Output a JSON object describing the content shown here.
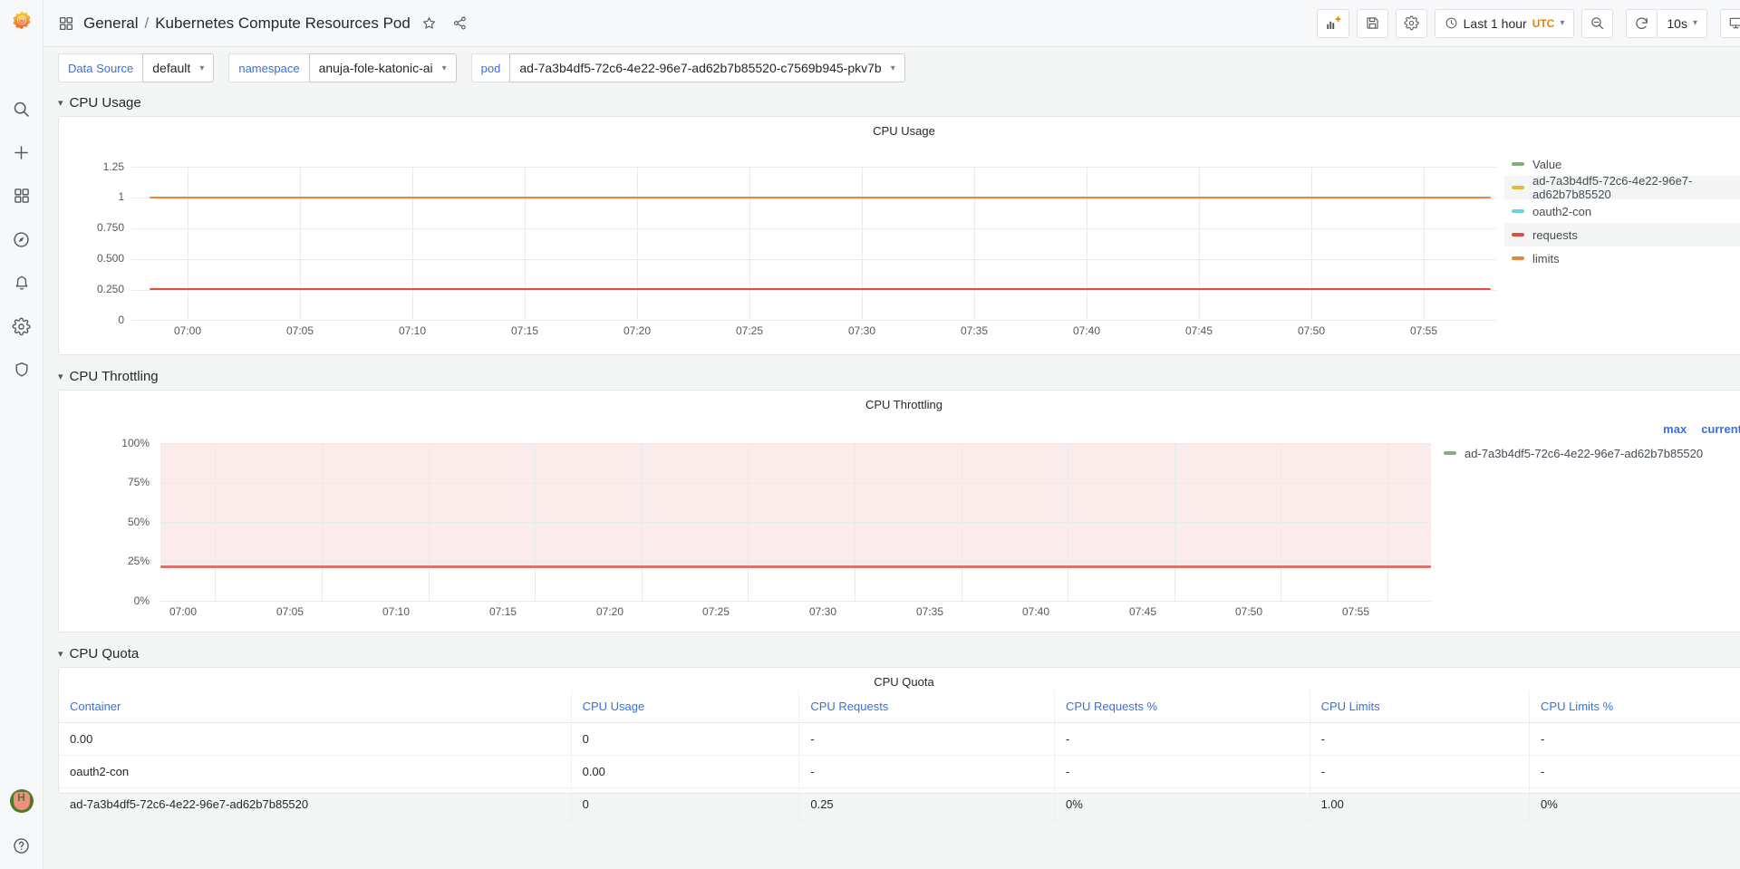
{
  "sidebar": {
    "logo": "grafana-logo",
    "items": [
      {
        "name": "search-icon",
        "label": "Search"
      },
      {
        "name": "plus-icon",
        "label": "Create"
      },
      {
        "name": "dashboards-icon",
        "label": "Dashboards"
      },
      {
        "name": "explore-compass-icon",
        "label": "Explore"
      },
      {
        "name": "alerting-bell-icon",
        "label": "Alerting"
      },
      {
        "name": "configuration-gear-icon",
        "label": "Configuration"
      },
      {
        "name": "shield-icon",
        "label": "Server Admin"
      }
    ],
    "bottom": [
      {
        "name": "avatar",
        "label": "H"
      },
      {
        "name": "help-icon",
        "label": "?"
      }
    ]
  },
  "topnav": {
    "folder": "General",
    "separator": "/",
    "dashboard_title": "Kubernetes Compute Resources Pod",
    "star_icon": "star-icon",
    "share_icon": "share-icon",
    "buttons": [
      {
        "name": "add-panel-button",
        "icon": "add-panel-icon"
      },
      {
        "name": "save-dashboard-button",
        "icon": "save-icon"
      },
      {
        "name": "dashboard-settings-button",
        "icon": "gear-icon"
      }
    ],
    "time_range": {
      "label": "Last 1 hour",
      "timezone": "UTC",
      "icon": "clock-icon"
    },
    "zoom_out": {
      "name": "zoom-out-button",
      "icon": "zoom-out-icon"
    },
    "refresh": {
      "name": "refresh-button",
      "icon": "refresh-icon"
    },
    "refresh_interval": "10s",
    "tv_mode": {
      "name": "tv-mode-button",
      "icon": "monitor-icon"
    }
  },
  "variables": [
    {
      "label": "Data Source",
      "value": "default"
    },
    {
      "label": "namespace",
      "value": "anuja-fole-katonic-ai"
    },
    {
      "label": "pod",
      "value": "ad-7a3b4df5-72c6-4e22-96e7-ad62b7b85520-c7569b945-pkv7b"
    }
  ],
  "rows": [
    {
      "title": "CPU Usage"
    },
    {
      "title": "CPU Throttling"
    },
    {
      "title": "CPU Quota"
    }
  ],
  "panels": {
    "cpu_usage": {
      "title": "CPU Usage"
    },
    "cpu_throttling": {
      "title": "CPU Throttling"
    },
    "cpu_quota": {
      "title": "CPU Quota"
    }
  },
  "chart_data": [
    {
      "type": "line",
      "title": "CPU Usage",
      "xlabel": "",
      "ylabel": "",
      "grid": true,
      "legend_position": "right",
      "x_ticks": [
        "07:00",
        "07:05",
        "07:10",
        "07:15",
        "07:20",
        "07:25",
        "07:30",
        "07:35",
        "07:40",
        "07:45",
        "07:50",
        "07:55"
      ],
      "y_ticks": [
        "0",
        "0.250",
        "0.500",
        "0.750",
        "1",
        "1.25"
      ],
      "ylim": [
        0,
        1.25
      ],
      "series": [
        {
          "name": "Value",
          "color": "#7eb26d",
          "values": []
        },
        {
          "name": "ad-7a3b4df5-72c6-4e22-96e7-ad62b7b85520",
          "color": "#eab839",
          "values": []
        },
        {
          "name": "oauth2-con",
          "color": "#6ed0e0",
          "values": []
        },
        {
          "name": "requests",
          "color": "#e24d42",
          "constant": 0.25
        },
        {
          "name": "limits",
          "color": "#ef843c",
          "constant": 1.0
        }
      ]
    },
    {
      "type": "line",
      "title": "CPU Throttling",
      "xlabel": "",
      "ylabel": "",
      "grid": true,
      "legend_position": "right",
      "legend_columns": [
        "max",
        "current"
      ],
      "x_ticks": [
        "07:00",
        "07:05",
        "07:10",
        "07:15",
        "07:20",
        "07:25",
        "07:30",
        "07:35",
        "07:40",
        "07:45",
        "07:50",
        "07:55"
      ],
      "y_ticks": [
        "0%",
        "25%",
        "50%",
        "75%",
        "100%"
      ],
      "ylim": [
        0,
        100
      ],
      "series": [
        {
          "name": "ad-7a3b4df5-72c6-4e22-96e7-ad62b7b85520",
          "color": "#7eb26d",
          "constant": 25,
          "fill": "#fbebeb",
          "line_color": "#e24d42"
        }
      ]
    },
    {
      "type": "table",
      "title": "CPU Quota",
      "columns": [
        "Container",
        "CPU Usage",
        "CPU Requests",
        "CPU Requests %",
        "CPU Limits",
        "CPU Limits %"
      ],
      "rows": [
        [
          "0.00",
          "0",
          "-",
          "-",
          "-",
          "-"
        ],
        [
          "oauth2-con",
          "0.00",
          "-",
          "-",
          "-",
          "-"
        ],
        [
          "ad-7a3b4df5-72c6-4e22-96e7-ad62b7b85520",
          "0",
          "0.25",
          "0%",
          "1.00",
          "0%"
        ]
      ]
    }
  ],
  "colors": {
    "accent_blue": "#3871dc",
    "orange": "#e8820c",
    "green": "#7eb26d",
    "yellow": "#eab839",
    "cyan": "#6ed0e0",
    "red": "#e24d42",
    "line_orange": "#ef843c",
    "throttle_fill": "#fbebeb"
  }
}
